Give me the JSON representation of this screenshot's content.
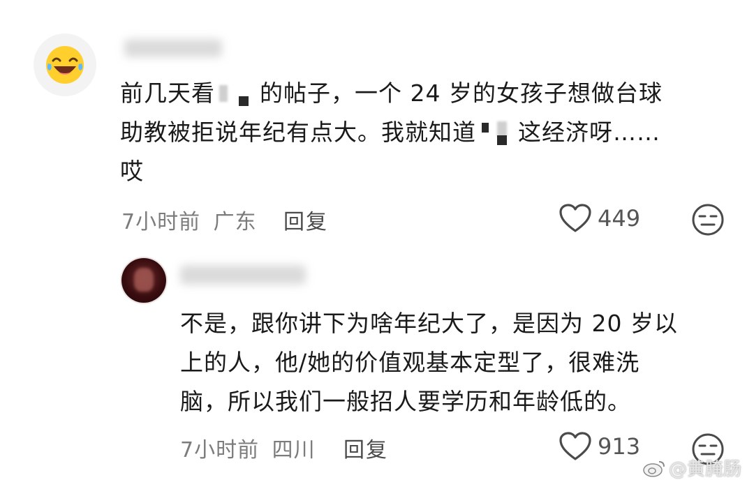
{
  "comment": {
    "line1a": "前几天看",
    "line1b": "的帖子，一个 24 岁的女孩子想做台球",
    "line2a": "助教被拒说年纪有点大。我就知道",
    "line2b": "这经济呀……",
    "line3": "哎",
    "time": "7小时前",
    "location": "广东",
    "reply_label": "回复",
    "likes": "449"
  },
  "reply": {
    "line1": "不是，跟你讲下为啥年纪大了，是因为 20 岁以",
    "line2": "上的人，他/她的价值观基本定型了，很难洗",
    "line3": "脑，所以我们一般招人要学历和年龄低的。",
    "time": "7小时前",
    "location": "四川",
    "reply_label": "回复",
    "likes": "913"
  },
  "watermark": "@黄腌肠",
  "icons": {
    "avatar_emoji": "laughing-tears-emoji-icon",
    "like": "heart-outline-icon",
    "dislike": "neutral-face-icon",
    "weibo": "weibo-logo-icon"
  }
}
